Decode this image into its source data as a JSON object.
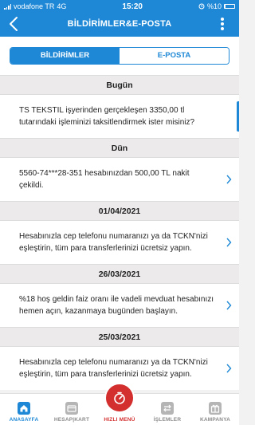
{
  "status_bar": {
    "carrier": "vodafone TR",
    "network": "4G",
    "time": "15:20",
    "battery": "%10"
  },
  "header": {
    "title": "BİLDİRİMLER&E-POSTA",
    "back_icon": "chevron-left-icon",
    "more_icon": "more-vertical-icon"
  },
  "tabs": [
    {
      "label": "BİLDİRİMLER",
      "active": true
    },
    {
      "label": "E-POSTA",
      "active": false
    }
  ],
  "sections": [
    {
      "date": "Bugün",
      "items": [
        {
          "text": "TS TEKSTIL işyerinden gerçekleşen 3350,00 tl tutarındaki işleminizi taksitlendirmek ister misiniz?"
        }
      ]
    },
    {
      "date": "Dün",
      "items": [
        {
          "text": "5560-74***28-351 hesabınızdan 500,00 TL nakit çekildi."
        }
      ]
    },
    {
      "date": "01/04/2021",
      "items": [
        {
          "text": "Hesabınızla cep telefonu numaranızı ya da TCKN'nizi eşleştirin, tüm para transferlerinizi ücretsiz yapın."
        }
      ]
    },
    {
      "date": "26/03/2021",
      "items": [
        {
          "text": "%18 hoş geldin faiz oranı ile vadeli mevduat hesabınızı hemen açın, kazanmaya bugünden başlayın."
        }
      ]
    },
    {
      "date": "25/03/2021",
      "items": [
        {
          "text": "Hesabınızla cep telefonu numaranızı ya da TCKN'nizi eşleştirin, tüm para transferlerinizi ücretsiz yapın."
        }
      ]
    }
  ],
  "bottom_nav": [
    {
      "label": "ANASAYFA",
      "icon": "home-icon",
      "active": true
    },
    {
      "label": "HESAP|KART",
      "icon": "card-icon",
      "active": false
    },
    {
      "label": "HIZLI MENÜ",
      "icon": "fast-menu-icon",
      "active": false
    },
    {
      "label": "İŞLEMLER",
      "icon": "transfer-icon",
      "active": false
    },
    {
      "label": "KAMPANYA",
      "icon": "gift-icon",
      "active": false
    }
  ],
  "colors": {
    "brand": "#1e88d6",
    "fab": "#d32f2f",
    "background": "#f2f2f2",
    "date_header": "#eceaea"
  }
}
